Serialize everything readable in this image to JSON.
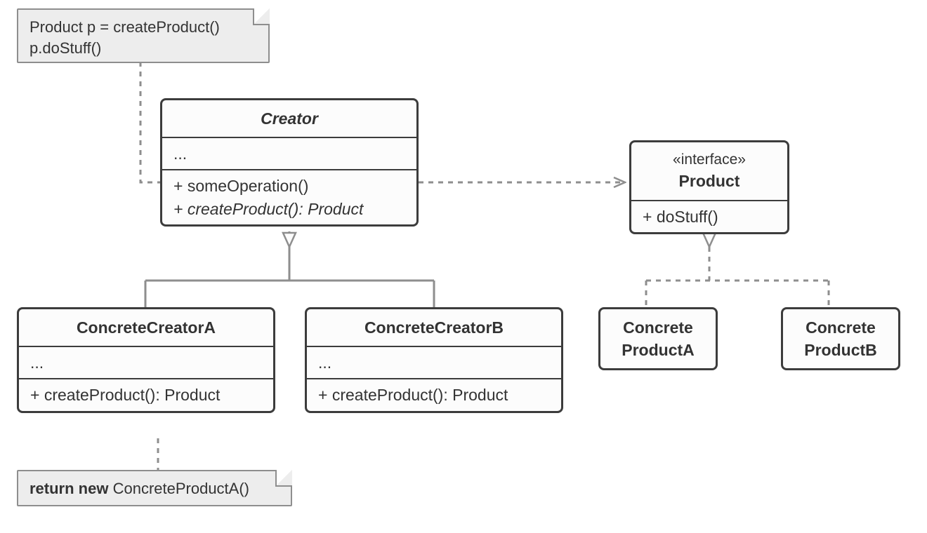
{
  "note_top": {
    "line1": "Product p = createProduct()",
    "line2": "p.doStuff()"
  },
  "creator": {
    "title": "Creator",
    "attrs": "...",
    "op1": "+ someOperation()",
    "op2": "+ createProduct(): Product"
  },
  "concrete_creator_a": {
    "title": "ConcreteCreatorA",
    "attrs": "...",
    "op1": "+ createProduct(): Product"
  },
  "concrete_creator_b": {
    "title": "ConcreteCreatorB",
    "attrs": "...",
    "op1": "+ createProduct(): Product"
  },
  "note_bottom": {
    "strong": "return new",
    "rest": " ConcreteProductA()"
  },
  "product": {
    "stereotype": "«interface»",
    "title": "Product",
    "op1": "+ doStuff()"
  },
  "concrete_product_a": {
    "line1": "Concrete",
    "line2": "ProductA"
  },
  "concrete_product_b": {
    "line1": "Concrete",
    "line2": "ProductB"
  }
}
